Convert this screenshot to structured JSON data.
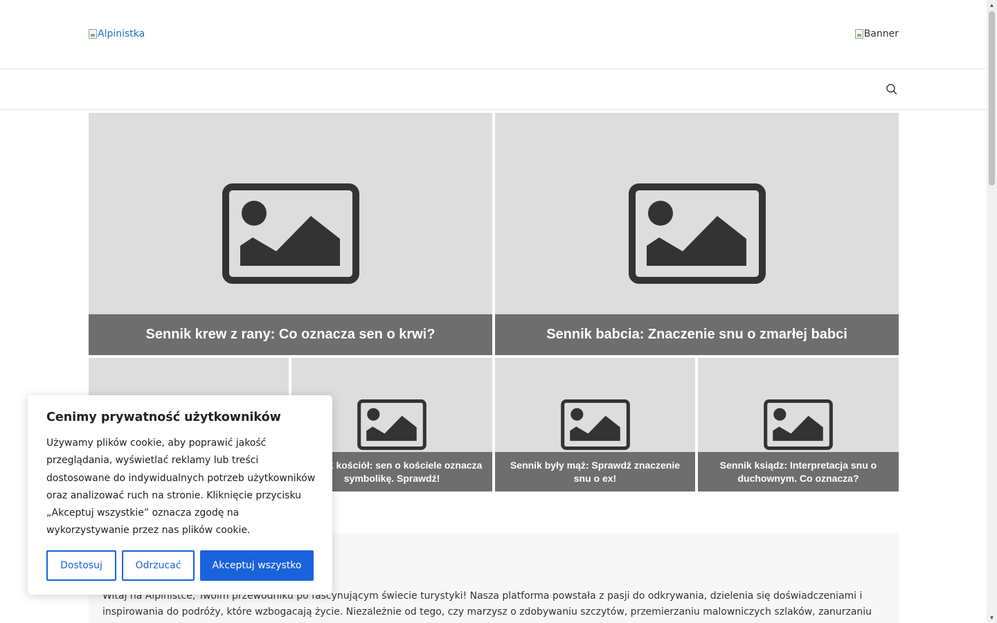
{
  "header": {
    "logo_alt": "Alpinistka",
    "banner_alt": "Banner"
  },
  "nav": {
    "search_icon": "search-icon"
  },
  "featured": {
    "big": [
      {
        "title": "Sennik krew z rany: Co oznacza sen o krwi?"
      },
      {
        "title": "Sennik babcia: Znaczenie snu o zmarłej babci"
      }
    ],
    "small": [
      {
        "title": ""
      },
      {
        "title": "Sennik kościół: sen o kościele oznacza symbolikę. Sprawdź!"
      },
      {
        "title": "Sennik były mąż: Sprawdź znaczenie snu o ex!"
      },
      {
        "title": "Sennik ksiądz: Interpretacja snu o duchownym. Co oznacza?"
      }
    ]
  },
  "about": {
    "text": "Witaj na Alpinistce, Twoim przewodniku po fascynującym świecie turystyki! Nasza platforma powstała z pasji do odkrywania, dzielenia się doświadczeniami i inspirowania do podróży, które wzbogacają życie. Niezależnie od tego, czy marzysz o zdobywaniu szczytów, przemierzaniu malowniczych szlaków, zanurzaniu się w kulturze odległych"
  },
  "cookie": {
    "title": "Cenimy prywatność użytkowników",
    "text": "Używamy plików cookie, aby poprawić jakość przeglądania, wyświetlać reklamy lub treści dostosowane do indywidualnych potrzeb użytkowników oraz analizować ruch na stronie. Kliknięcie przycisku „Akceptuj wszystkie” oznacza zgodę na wykorzystywanie przez nas plików cookie.",
    "customize_label": "Dostosuj",
    "reject_label": "Odrzucać",
    "accept_label": "Akceptuj wszystko"
  },
  "colors": {
    "accent": "#1863dc",
    "caption_bg": "#6e6e6e",
    "placeholder_bg": "#dddddd",
    "logo_link": "#1e73be"
  }
}
